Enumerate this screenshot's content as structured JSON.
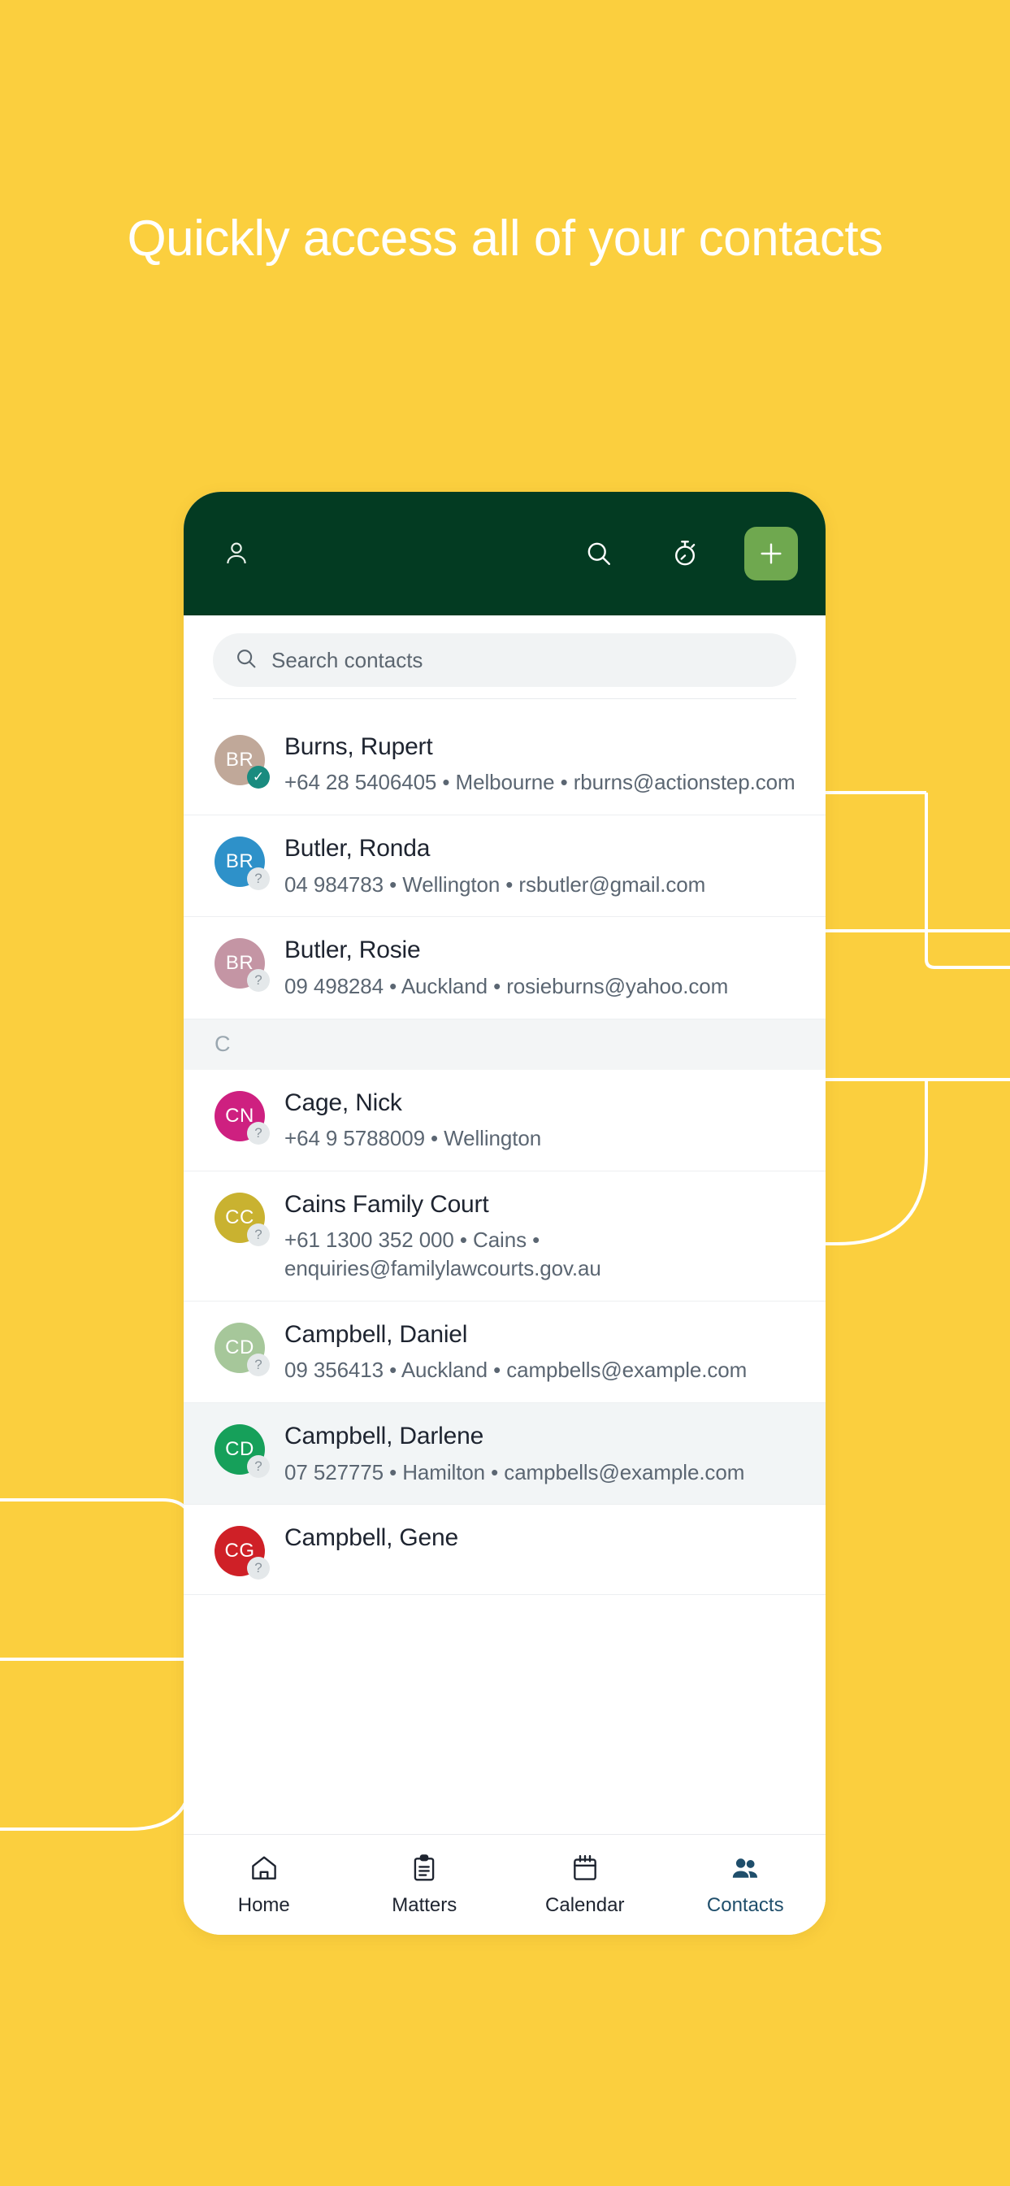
{
  "page": {
    "background_color": "#FBCF3E",
    "headline": "Quickly access all of your contacts"
  },
  "app": {
    "header": {
      "profile_icon": "person-icon",
      "search_icon": "search-icon",
      "timer_icon": "stopwatch-icon",
      "add_label": "+",
      "background_color": "#033B22",
      "add_button_color": "#6FA84F"
    },
    "search": {
      "placeholder": "Search contacts",
      "icon": "search-icon"
    },
    "sections": [
      {
        "letter": "",
        "contacts": [
          {
            "initials": "BR",
            "name": "Burns, Rupert",
            "meta": "+64 28 5406405 • Melbourne • rburns@actionstep.com",
            "avatar_color": "#C0A899",
            "badge": "verified",
            "badge_glyph": "✓",
            "selected": false
          },
          {
            "initials": "BR",
            "name": "Butler, Ronda",
            "meta": "04 984783 • Wellington • rsbutler@gmail.com",
            "avatar_color": "#2E91C9",
            "badge": "unknown",
            "badge_glyph": "?",
            "selected": false
          },
          {
            "initials": "BR",
            "name": "Butler, Rosie",
            "meta": "09 498284 • Auckland • rosieburns@yahoo.com",
            "avatar_color": "#C happens",
            "badge": "unknown",
            "badge_glyph": "?",
            "selected": false
          }
        ]
      },
      {
        "letter": "C",
        "contacts": [
          {
            "initials": "CN",
            "name": "Cage, Nick",
            "meta": "+64 9 5788009 • Wellington",
            "avatar_color": "#CE2080",
            "badge": "unknown",
            "badge_glyph": "?",
            "selected": false
          },
          {
            "initials": "CC",
            "name": "Cains Family Court",
            "meta": "+61 1300 352 000 • Cains • enquiries@familylawcourts.gov.au",
            "avatar_color": "#C9B230",
            "badge": "unknown",
            "badge_glyph": "?",
            "selected": false
          },
          {
            "initials": "CD",
            "name": "Campbell, Daniel",
            "meta": "09 356413 • Auckland • campbells@example.com",
            "avatar_color": "#A6C79A",
            "badge": "unknown",
            "badge_glyph": "?",
            "selected": false
          },
          {
            "initials": "CD",
            "name": "Campbell, Darlene",
            "meta": "07 527775 • Hamilton • campbells@example.com",
            "avatar_color": "#16A05A",
            "badge": "unknown",
            "badge_glyph": "?",
            "selected": true
          },
          {
            "initials": "CG",
            "name": "Campbell, Gene",
            "meta": "",
            "avatar_color": "#CF2027",
            "badge": "unknown",
            "badge_glyph": "?",
            "selected": false
          }
        ]
      }
    ],
    "bottom_nav": {
      "active_color": "#1F4E6B",
      "items": [
        {
          "label": "Home",
          "icon": "home-icon",
          "active": false
        },
        {
          "label": "Matters",
          "icon": "clipboard-icon",
          "active": false
        },
        {
          "label": "Calendar",
          "icon": "calendar-icon",
          "active": false
        },
        {
          "label": "Contacts",
          "icon": "people-icon",
          "active": true
        }
      ]
    }
  }
}
